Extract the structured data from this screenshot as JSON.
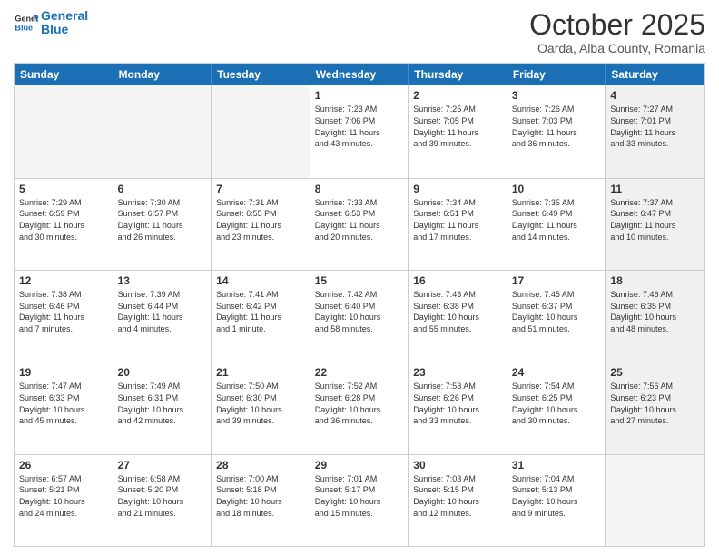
{
  "header": {
    "logo_general": "General",
    "logo_blue": "Blue",
    "month_title": "October 2025",
    "location": "Oarda, Alba County, Romania"
  },
  "days_of_week": [
    "Sunday",
    "Monday",
    "Tuesday",
    "Wednesday",
    "Thursday",
    "Friday",
    "Saturday"
  ],
  "weeks": [
    [
      {
        "day": "",
        "empty": true
      },
      {
        "day": "",
        "empty": true
      },
      {
        "day": "",
        "empty": true
      },
      {
        "day": "1",
        "lines": [
          "Sunrise: 7:23 AM",
          "Sunset: 7:06 PM",
          "Daylight: 11 hours",
          "and 43 minutes."
        ]
      },
      {
        "day": "2",
        "lines": [
          "Sunrise: 7:25 AM",
          "Sunset: 7:05 PM",
          "Daylight: 11 hours",
          "and 39 minutes."
        ]
      },
      {
        "day": "3",
        "lines": [
          "Sunrise: 7:26 AM",
          "Sunset: 7:03 PM",
          "Daylight: 11 hours",
          "and 36 minutes."
        ]
      },
      {
        "day": "4",
        "lines": [
          "Sunrise: 7:27 AM",
          "Sunset: 7:01 PM",
          "Daylight: 11 hours",
          "and 33 minutes."
        ],
        "shaded": true
      }
    ],
    [
      {
        "day": "5",
        "lines": [
          "Sunrise: 7:29 AM",
          "Sunset: 6:59 PM",
          "Daylight: 11 hours",
          "and 30 minutes."
        ]
      },
      {
        "day": "6",
        "lines": [
          "Sunrise: 7:30 AM",
          "Sunset: 6:57 PM",
          "Daylight: 11 hours",
          "and 26 minutes."
        ]
      },
      {
        "day": "7",
        "lines": [
          "Sunrise: 7:31 AM",
          "Sunset: 6:55 PM",
          "Daylight: 11 hours",
          "and 23 minutes."
        ]
      },
      {
        "day": "8",
        "lines": [
          "Sunrise: 7:33 AM",
          "Sunset: 6:53 PM",
          "Daylight: 11 hours",
          "and 20 minutes."
        ]
      },
      {
        "day": "9",
        "lines": [
          "Sunrise: 7:34 AM",
          "Sunset: 6:51 PM",
          "Daylight: 11 hours",
          "and 17 minutes."
        ]
      },
      {
        "day": "10",
        "lines": [
          "Sunrise: 7:35 AM",
          "Sunset: 6:49 PM",
          "Daylight: 11 hours",
          "and 14 minutes."
        ]
      },
      {
        "day": "11",
        "lines": [
          "Sunrise: 7:37 AM",
          "Sunset: 6:47 PM",
          "Daylight: 11 hours",
          "and 10 minutes."
        ],
        "shaded": true
      }
    ],
    [
      {
        "day": "12",
        "lines": [
          "Sunrise: 7:38 AM",
          "Sunset: 6:46 PM",
          "Daylight: 11 hours",
          "and 7 minutes."
        ]
      },
      {
        "day": "13",
        "lines": [
          "Sunrise: 7:39 AM",
          "Sunset: 6:44 PM",
          "Daylight: 11 hours",
          "and 4 minutes."
        ]
      },
      {
        "day": "14",
        "lines": [
          "Sunrise: 7:41 AM",
          "Sunset: 6:42 PM",
          "Daylight: 11 hours",
          "and 1 minute."
        ]
      },
      {
        "day": "15",
        "lines": [
          "Sunrise: 7:42 AM",
          "Sunset: 6:40 PM",
          "Daylight: 10 hours",
          "and 58 minutes."
        ]
      },
      {
        "day": "16",
        "lines": [
          "Sunrise: 7:43 AM",
          "Sunset: 6:38 PM",
          "Daylight: 10 hours",
          "and 55 minutes."
        ]
      },
      {
        "day": "17",
        "lines": [
          "Sunrise: 7:45 AM",
          "Sunset: 6:37 PM",
          "Daylight: 10 hours",
          "and 51 minutes."
        ]
      },
      {
        "day": "18",
        "lines": [
          "Sunrise: 7:46 AM",
          "Sunset: 6:35 PM",
          "Daylight: 10 hours",
          "and 48 minutes."
        ],
        "shaded": true
      }
    ],
    [
      {
        "day": "19",
        "lines": [
          "Sunrise: 7:47 AM",
          "Sunset: 6:33 PM",
          "Daylight: 10 hours",
          "and 45 minutes."
        ]
      },
      {
        "day": "20",
        "lines": [
          "Sunrise: 7:49 AM",
          "Sunset: 6:31 PM",
          "Daylight: 10 hours",
          "and 42 minutes."
        ]
      },
      {
        "day": "21",
        "lines": [
          "Sunrise: 7:50 AM",
          "Sunset: 6:30 PM",
          "Daylight: 10 hours",
          "and 39 minutes."
        ]
      },
      {
        "day": "22",
        "lines": [
          "Sunrise: 7:52 AM",
          "Sunset: 6:28 PM",
          "Daylight: 10 hours",
          "and 36 minutes."
        ]
      },
      {
        "day": "23",
        "lines": [
          "Sunrise: 7:53 AM",
          "Sunset: 6:26 PM",
          "Daylight: 10 hours",
          "and 33 minutes."
        ]
      },
      {
        "day": "24",
        "lines": [
          "Sunrise: 7:54 AM",
          "Sunset: 6:25 PM",
          "Daylight: 10 hours",
          "and 30 minutes."
        ]
      },
      {
        "day": "25",
        "lines": [
          "Sunrise: 7:56 AM",
          "Sunset: 6:23 PM",
          "Daylight: 10 hours",
          "and 27 minutes."
        ],
        "shaded": true
      }
    ],
    [
      {
        "day": "26",
        "lines": [
          "Sunrise: 6:57 AM",
          "Sunset: 5:21 PM",
          "Daylight: 10 hours",
          "and 24 minutes."
        ]
      },
      {
        "day": "27",
        "lines": [
          "Sunrise: 6:58 AM",
          "Sunset: 5:20 PM",
          "Daylight: 10 hours",
          "and 21 minutes."
        ]
      },
      {
        "day": "28",
        "lines": [
          "Sunrise: 7:00 AM",
          "Sunset: 5:18 PM",
          "Daylight: 10 hours",
          "and 18 minutes."
        ]
      },
      {
        "day": "29",
        "lines": [
          "Sunrise: 7:01 AM",
          "Sunset: 5:17 PM",
          "Daylight: 10 hours",
          "and 15 minutes."
        ]
      },
      {
        "day": "30",
        "lines": [
          "Sunrise: 7:03 AM",
          "Sunset: 5:15 PM",
          "Daylight: 10 hours",
          "and 12 minutes."
        ]
      },
      {
        "day": "31",
        "lines": [
          "Sunrise: 7:04 AM",
          "Sunset: 5:13 PM",
          "Daylight: 10 hours",
          "and 9 minutes."
        ]
      },
      {
        "day": "",
        "empty": true,
        "shaded": true
      }
    ]
  ]
}
